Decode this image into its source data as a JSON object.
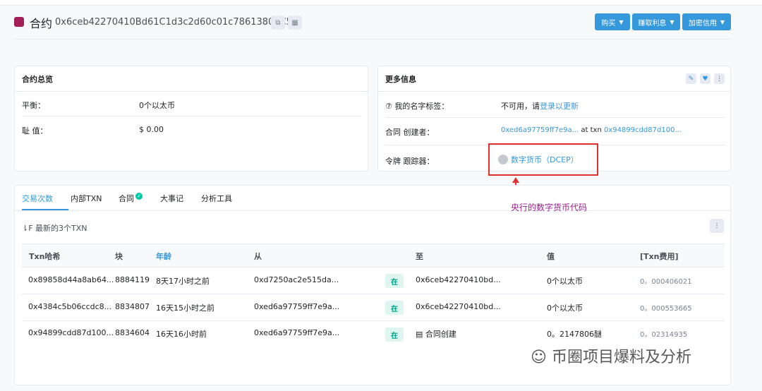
{
  "header": {
    "title": "合约",
    "address": "0x6ceb42270410Bd61C1d3c2d60c01c78613803C54",
    "buttons": [
      "购买",
      "赚取利息",
      "加密信用"
    ]
  },
  "overview": {
    "title": "合约总览",
    "balance_label": "平衡：",
    "balance_value": "0个以太币",
    "value_label": "耻 值：",
    "value_value": "$ 0.00"
  },
  "more_info": {
    "title": "更多信息",
    "tag_label": "⑦ 我的名字标签：",
    "tag_prefix": "不可用，请",
    "tag_link": "登录以更新",
    "creator_label": "合同 创建者：",
    "creator_addr": "0xed6a97759ff7e9a...",
    "creator_at": " at txn ",
    "creator_txn": "0x94899cdd87d100...",
    "tracker_label": "令牌 跟踪器：",
    "tracker_value": "数字货币（DCEP）"
  },
  "annotation": "央行的数字货币代码",
  "tabs": [
    "交易次数",
    "内部TXN",
    "合同",
    "大事记",
    "分析工具"
  ],
  "latest": "⇂F 最新的3个TXN",
  "table": {
    "headers": [
      "Txn哈希",
      "块",
      "年龄",
      "从",
      "至",
      "值",
      "[Txn费用]"
    ],
    "rows": [
      {
        "hash": "0x89858d44a8ab64...",
        "block": "8884119",
        "age": "8天17小时之前",
        "from": "0xd7250ac2e515da...",
        "dir": "在",
        "to": "0x6ceb42270410bd...",
        "value": "0个以太币",
        "fee": "0。000406021"
      },
      {
        "hash": "0x4384c5b06ccdc8...",
        "block": "8834807",
        "age": "16天15小时之前",
        "from": "0xed6a97759ff7e9a...",
        "dir": "在",
        "to": "0x6ceb42270410bd...",
        "value": "0个以太币",
        "fee": "0。000553665"
      },
      {
        "hash": "0x94899cdd87d100...",
        "block": "8834604",
        "age": "16天16小时前",
        "from": "0xed6a97759ff7e9a...",
        "dir": "在",
        "to": "▤ 合同创建",
        "value": "0。2147806醚",
        "fee": "0。02314935"
      }
    ]
  },
  "watermark": "币圈项目爆料及分析"
}
